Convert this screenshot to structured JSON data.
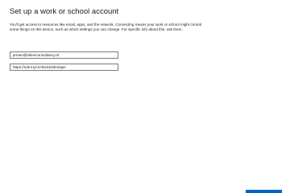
{
  "dialog": {
    "title": "Set up a work or school account",
    "description": "You'll get access to resources like email, apps, and the network. Connecting means your work or school might control some things on this device, such as which settings you can change. For specific info about this, ask them."
  },
  "fields": {
    "email_value": "jeroen@tielenconsultancy.nl",
    "server_value": "https://ndmi.tyl.nl:8443/zdm/wpe"
  },
  "colors": {
    "accent": "#0067c0",
    "field_border": "#7a7a7a"
  }
}
